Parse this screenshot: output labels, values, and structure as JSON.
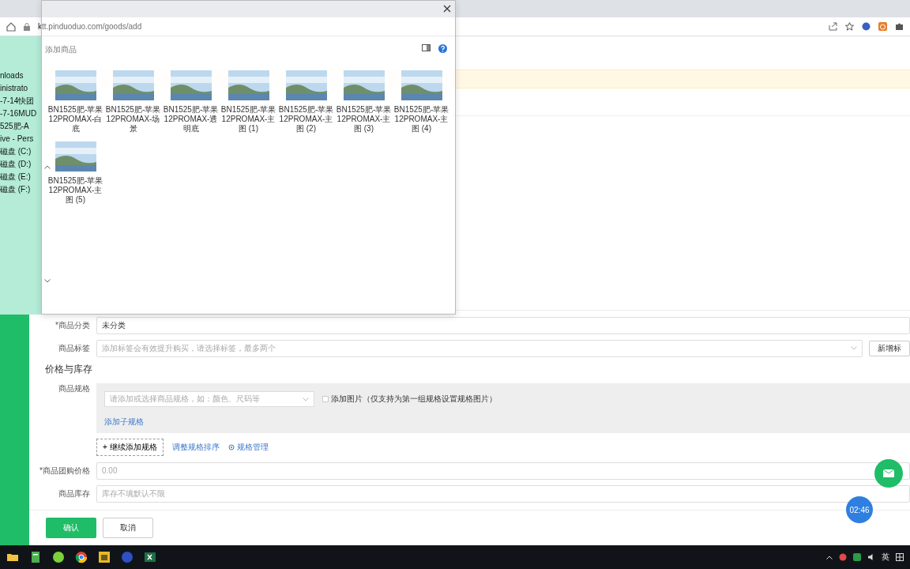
{
  "browser": {
    "url": "ktt.pinduoduo.com/goods/add"
  },
  "page": {
    "title": "添加商品",
    "category": {
      "label": "*商品分类",
      "value": "未分类"
    },
    "tags": {
      "label": "商品标签",
      "placeholder": "添加标签会有效提升购买，请选择标签，最多两个",
      "button": "新增标"
    },
    "price_section": "价格与库存",
    "spec": {
      "label": "商品规格",
      "placeholder": "请添加或选择商品规格，如：颜色、尺码等",
      "add_image": {
        "label": "添加图片（仅支持为第一组规格设置规格图片）",
        "checked": false
      },
      "add_sub": "添加子规格",
      "add_spec": "+ 继续添加规格",
      "sort_link": "调整规格排序",
      "manage_link": "规格管理"
    },
    "price": {
      "label": "*商品团购价格",
      "placeholder": "0.00"
    },
    "stock": {
      "label": "商品库存",
      "placeholder": "库存不填默认不限"
    },
    "buttons": [
      {
        "label": "确认",
        "kind": "primary"
      },
      {
        "label": "取消",
        "kind": "default"
      }
    ],
    "timer": "02:46"
  },
  "file_dialog": {
    "nav_items": [
      "nloads",
      "inistrato",
      "-7-14快团",
      "-7-16MUD",
      "525肥-A",
      "ive - Pers",
      "磁盘 (C:)",
      "磁盘 (D:)",
      "磁盘 (E:)",
      "磁盘 (F:)"
    ],
    "files": [
      {
        "name": "BN1525肥-苹果12PROMAX-白底"
      },
      {
        "name": "BN1525肥-苹果12PROMAX-场景"
      },
      {
        "name": "BN1525肥-苹果12PROMAX-透明底"
      },
      {
        "name": "BN1525肥-苹果12PROMAX-主图 (1)"
      },
      {
        "name": "BN1525肥-苹果12PROMAX-主图 (2)"
      },
      {
        "name": "BN1525肥-苹果12PROMAX-主图 (3)"
      },
      {
        "name": "BN1525肥-苹果12PROMAX-主图 (4)"
      },
      {
        "name": "BN1525肥-苹果12PROMAX-主图 (5)"
      }
    ]
  },
  "taskbar": {
    "language": "英"
  }
}
